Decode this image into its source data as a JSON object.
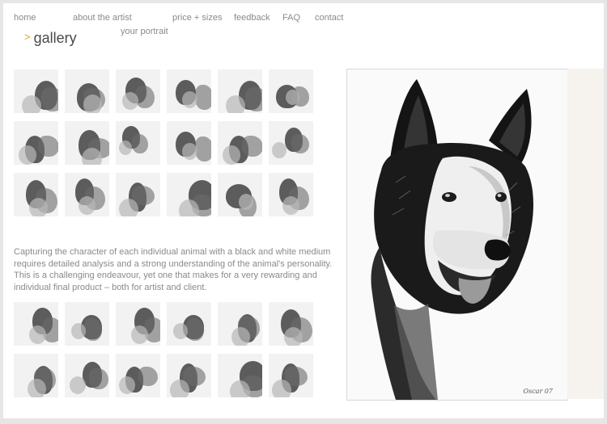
{
  "nav": {
    "home": "home",
    "about": "about the artist",
    "portrait": "your portrait",
    "price": "price + sizes",
    "feedback": "feedback",
    "faq": "FAQ",
    "contact": "contact"
  },
  "section": {
    "arrow": ">",
    "title": "gallery"
  },
  "gallery_top": [
    {
      "subject": "horses"
    },
    {
      "subject": "horse-head"
    },
    {
      "subject": "horse-head"
    },
    {
      "subject": "dogs"
    },
    {
      "subject": "horse-legs"
    },
    {
      "subject": "horse-bridle"
    },
    {
      "subject": "dog-head"
    },
    {
      "subject": "horse-head"
    },
    {
      "subject": "dog-head"
    },
    {
      "subject": "horse-head"
    },
    {
      "subject": "horse-bridle"
    },
    {
      "subject": "puppy"
    },
    {
      "subject": "horse-rider"
    },
    {
      "subject": "dog-head"
    },
    {
      "subject": "horse-legs"
    },
    {
      "subject": "dog-head"
    },
    {
      "subject": "horse-legs"
    },
    {
      "subject": "horse-bridle"
    }
  ],
  "description": "Capturing the character of each individual animal with a black and white medium requires detailed analysis and a strong understanding of the animal's personality. This is a challenging endeavour, yet one that makes for a very rewarding and individual final product – both for artist and client.",
  "gallery_bottom": [
    {
      "subject": "horse-head"
    },
    {
      "subject": "horse-head"
    },
    {
      "subject": "horse-bridle"
    },
    {
      "subject": "horse-bridle"
    },
    {
      "subject": "dog-head"
    },
    {
      "subject": "dog-lying"
    },
    {
      "subject": "horse-legs"
    },
    {
      "subject": "horse-head"
    },
    {
      "subject": "horse-rider"
    },
    {
      "subject": "horse-head"
    },
    {
      "subject": "dog-head"
    },
    {
      "subject": "horse-bridle"
    }
  ],
  "feature": {
    "subject": "dog-portrait",
    "signature": "Oscar 07"
  },
  "colors": {
    "accent": "#e8a317",
    "nav_text": "#8a8a8a",
    "frame_bg": "#e6e6e6"
  }
}
